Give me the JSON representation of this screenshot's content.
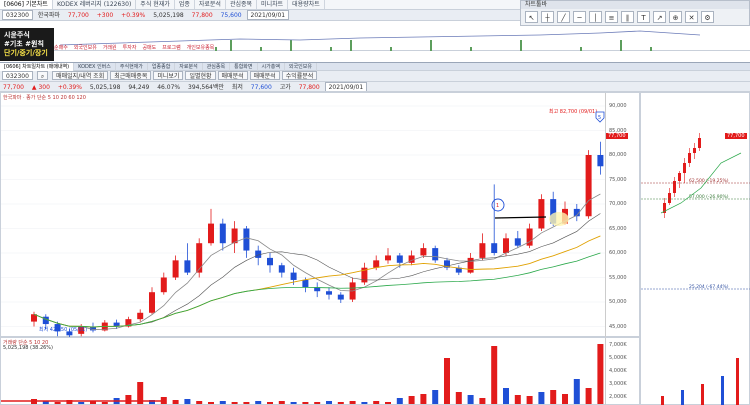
{
  "top_window": {
    "title_tabs": [
      "[0606] 기본차트",
      "KODEX 레버리지 (122630)",
      "주식 현재가",
      "업종",
      "자료분석",
      "관심종목",
      "미니차트",
      "대용량차트"
    ],
    "code": "032300",
    "name": "한국파마",
    "price": "77,700",
    "change": "+300",
    "pct": "+0.39%",
    "volume": "5,025,198",
    "high": "77,800",
    "low": "75,600",
    "date": "2021/09/01",
    "indicator_buttons": [
      "1분",
      "2분",
      "3분",
      "5분",
      "10분",
      "일",
      "주",
      "월"
    ]
  },
  "side_label": {
    "line1": "시윤주식",
    "line2": "#기초 #원칙",
    "line3": "단기/중기/장기"
  },
  "tool_window": {
    "title": "차트툴바",
    "tools": [
      "cursor-tool",
      "crosshair-tool",
      "trendline-tool",
      "horizontal-line-tool",
      "vertical-line-tool",
      "fibo-tool",
      "channel-tool",
      "text-tool",
      "arrow-tool",
      "zoom-tool",
      "delete-tool",
      "settings-tool"
    ]
  },
  "tab_bar": {
    "items": [
      "순매수",
      "외국인보유",
      "거래원",
      "투자자",
      "공매도",
      "프로그램",
      "개인보유종목"
    ]
  },
  "chart_window": {
    "toolbar1": [
      "[0606] 차트일차트 (매매내역)",
      "KODEX 인버스",
      "주식현재가",
      "업종종합",
      "자료분석",
      "관심종목",
      "통합화면",
      "시가총액",
      "외국인보유"
    ],
    "code": "032300",
    "search_placeholder": "한국파마",
    "toolbar2_buttons": [
      "매매일지/내역 조회",
      "최근매매종목",
      "미니보기",
      "일별현황",
      "매매분석",
      "매매분석",
      "수익률분석"
    ],
    "price_row": {
      "price": "77,700",
      "change": "▲ 300",
      "pct": "+0.39%",
      "volume": "5,025,198",
      "turnover": "94,249",
      "ratio": "46.07%",
      "amount": "394,564백만",
      "low_label": "최저",
      "low": "77,600",
      "high_label": "고가",
      "high": "77,800",
      "date": "2021/09/01"
    },
    "legend": "한국파마 · 종가 단순 5 10 20 60 120",
    "volume_legend": "거래량 단순 5 10 20",
    "volume_value": "5,025,198 (38.26%)"
  },
  "chart_data": {
    "type": "candlestick",
    "annotations": {
      "high_marker": "최고 82,700 (09/01)",
      "low_marker": "최저 42,450 (05/01)",
      "circle_1": "1",
      "circle_5": "5",
      "fib_levels": [
        "62,500 (-19.25%)",
        "57,000 (-26.90%)",
        "25,204 (-67.44%)"
      ]
    },
    "y_ticks": [
      "90,000",
      "85,000",
      "80,000",
      "75,000",
      "70,000",
      "65,000",
      "60,000",
      "55,000",
      "50,000",
      "45,000"
    ],
    "current_price_tag": "77,700",
    "volume_ticks": [
      "7,000K",
      "5,000K",
      "4,000K",
      "3,000K",
      "2,000K"
    ]
  },
  "colors": {
    "up": "#e21b1b",
    "down": "#1f4fd6",
    "ma5": "#888888",
    "ma20": "#e0a100",
    "ma60": "#2aa84a"
  }
}
